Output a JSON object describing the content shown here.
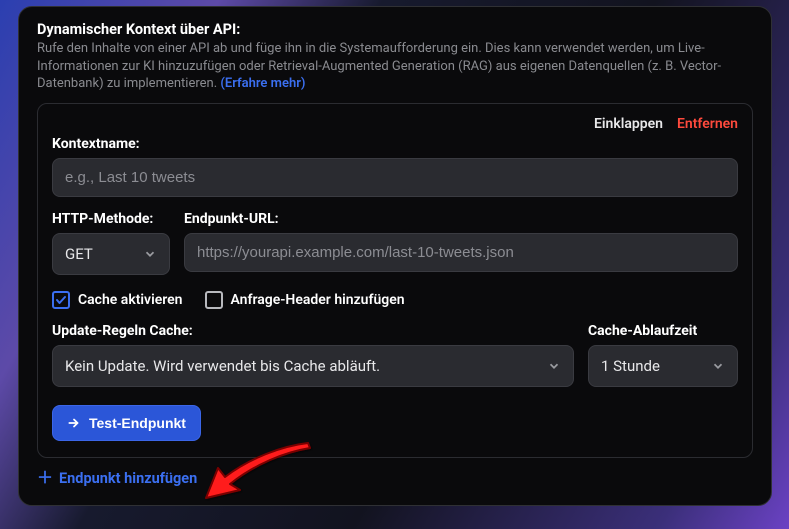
{
  "header": {
    "title": "Dynamischer Kontext über API:",
    "description_pre": "Rufe den Inhalte von einer API ab und füge ihn in die Systemaufforderung ein. Dies kann verwendet werden, um Live-Informationen zur KI hinzuzufügen oder Retrieval-Augmented Generation (RAG) aus eigenen Datenquellen (z. B. Vector-Datenbank) zu implementieren. ",
    "learn_more": "(Erfahre mehr)"
  },
  "card": {
    "collapse_label": "Einklappen",
    "remove_label": "Entfernen",
    "fields": {
      "context_name_label": "Kontextname:",
      "context_name_placeholder": "e.g., Last 10 tweets",
      "context_name_value": "",
      "http_method_label": "HTTP-Methode:",
      "http_method_value": "GET",
      "endpoint_url_label": "Endpunkt-URL:",
      "endpoint_url_placeholder": "https://yourapi.example.com/last-10-tweets.json",
      "endpoint_url_value": ""
    },
    "checkboxes": {
      "cache_enable_label": "Cache aktivieren",
      "cache_enable_checked": true,
      "add_headers_label": "Anfrage-Header hinzufügen",
      "add_headers_checked": false
    },
    "rules": {
      "update_rules_label": "Update-Regeln Cache:",
      "update_rules_value": "Kein Update. Wird verwendet bis Cache abläuft.",
      "ttl_label": "Cache-Ablaufzeit",
      "ttl_value": "1 Stunde"
    },
    "test_button": "Test-Endpunkt"
  },
  "footer": {
    "add_endpoint_label": "Endpunkt hinzufügen"
  }
}
